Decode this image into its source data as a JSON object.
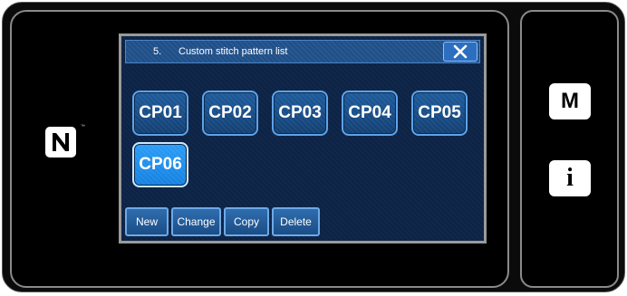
{
  "dialog": {
    "number": "5.",
    "title": "Custom stitch pattern list"
  },
  "patterns": [
    {
      "label": "CP01",
      "selected": false
    },
    {
      "label": "CP02",
      "selected": false
    },
    {
      "label": "CP03",
      "selected": false
    },
    {
      "label": "CP04",
      "selected": false
    },
    {
      "label": "CP05",
      "selected": false
    },
    {
      "label": "CP06",
      "selected": true
    }
  ],
  "actions": {
    "new": "New",
    "change": "Change",
    "copy": "Copy",
    "delete": "Delete"
  },
  "side": {
    "mode_label": "M",
    "info_label": "i"
  },
  "icons": {
    "close": "close-icon",
    "nfc": "nfc-icon"
  },
  "nfc_trademark": "™",
  "colors": {
    "screen_bg": "#0c2346",
    "button_blue": "#1d5a9c",
    "selected_blue": "#1a8cee"
  }
}
